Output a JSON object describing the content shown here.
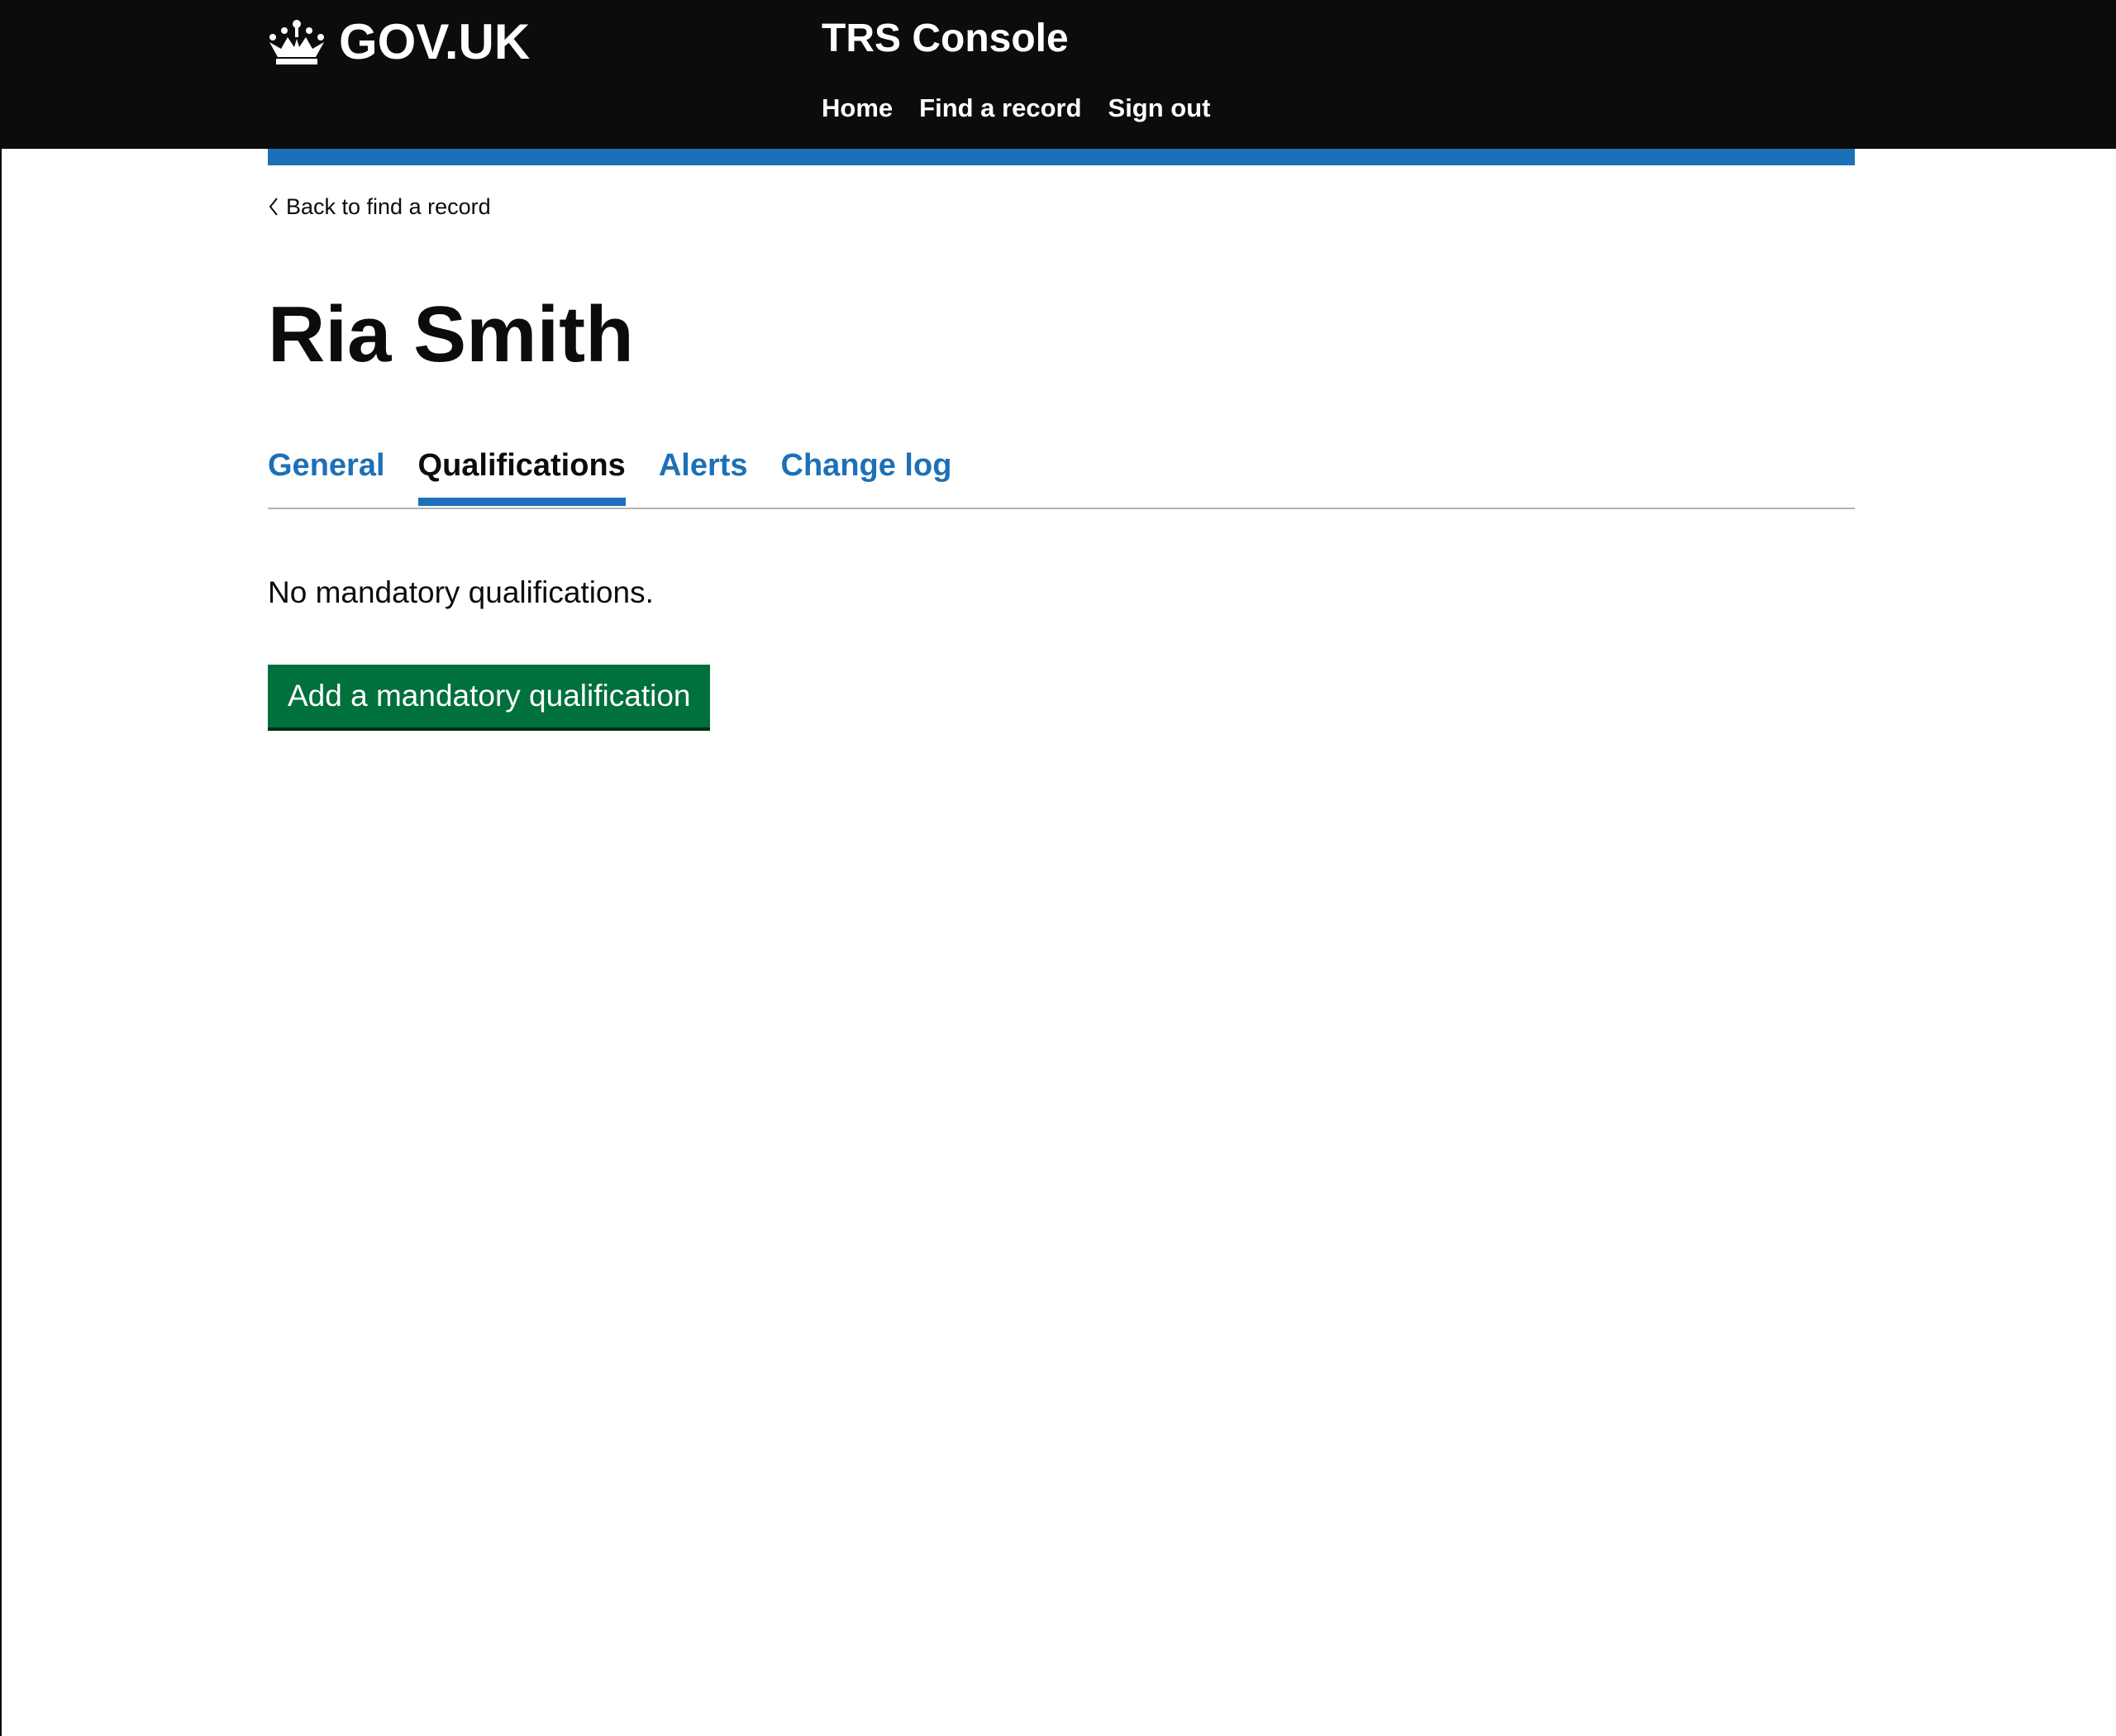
{
  "header": {
    "logo_text": "GOV.UK",
    "service_name": "TRS Console",
    "nav": [
      {
        "label": "Home"
      },
      {
        "label": "Find a record"
      },
      {
        "label": "Sign out"
      }
    ]
  },
  "back_link": {
    "label": "Back to find a record"
  },
  "page": {
    "title": "Ria Smith"
  },
  "tabs": [
    {
      "label": "General",
      "active": false
    },
    {
      "label": "Qualifications",
      "active": true
    },
    {
      "label": "Alerts",
      "active": false
    },
    {
      "label": "Change log",
      "active": false
    }
  ],
  "qualifications": {
    "empty_message": "No mandatory qualifications.",
    "add_button_label": "Add a mandatory qualification"
  },
  "colors": {
    "header_background": "#0b0c0c",
    "brand_blue": "#1d70b8",
    "button_green": "#00703c"
  },
  "icons": {
    "logo": "crown-icon",
    "back": "chevron-left-icon"
  }
}
